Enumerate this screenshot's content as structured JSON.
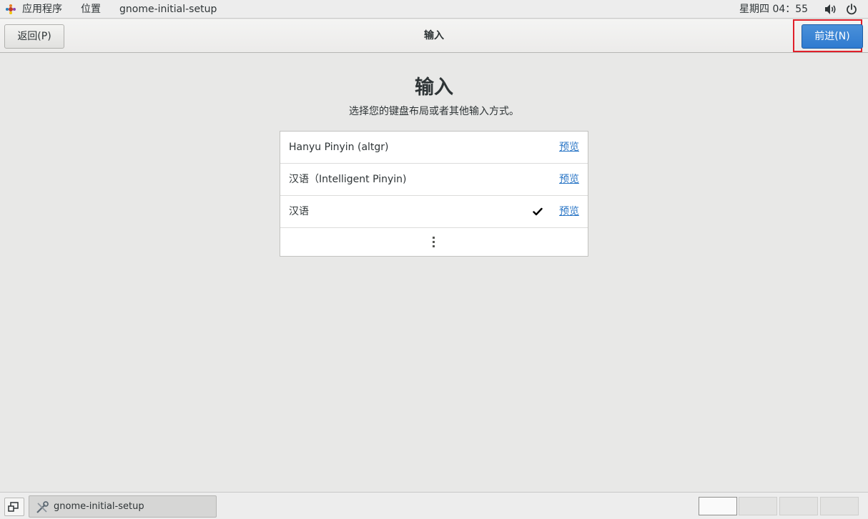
{
  "top_panel": {
    "applications_label": "应用程序",
    "places_label": "位置",
    "window_label": "gnome-initial-setup",
    "clock": "星期四 04：55"
  },
  "header": {
    "back_label": "返回(P)",
    "title": "输入",
    "next_label": "前进(N)"
  },
  "main": {
    "heading": "输入",
    "subtitle": "选择您的键盘布局或者其他输入方式。",
    "sources": [
      {
        "label": "Hanyu Pinyin (altgr)",
        "preview_label": "预览",
        "selected": false
      },
      {
        "label": "汉语（Intelligent Pinyin)",
        "preview_label": "预览",
        "selected": false
      },
      {
        "label": "汉语",
        "preview_label": "预览",
        "selected": true
      }
    ]
  },
  "taskbar": {
    "task_label": "gnome-initial-setup",
    "workspaces": [
      {
        "active": true
      },
      {
        "active": false
      },
      {
        "active": false
      },
      {
        "active": false
      }
    ]
  },
  "colors": {
    "accent": "#2f7bd0",
    "link": "#2a76c6",
    "highlight_box": "#e0202a"
  }
}
